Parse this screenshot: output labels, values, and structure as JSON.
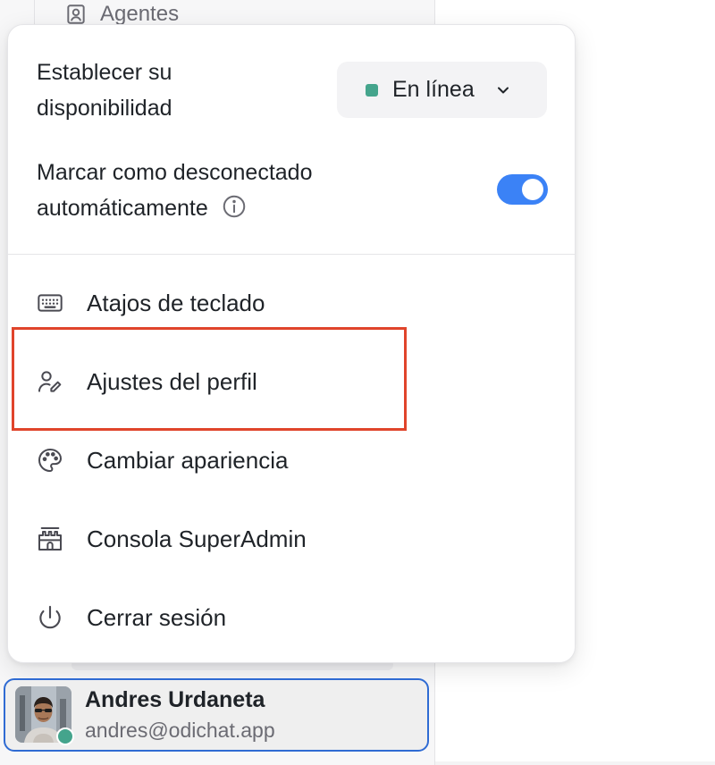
{
  "background": {
    "sidebar_item_label": "Agentes"
  },
  "availability": {
    "label": "Establecer su disponibilidad",
    "status_label": "En línea",
    "status_color": "#44a48c"
  },
  "auto_offline": {
    "label": "Marcar como desconectado automáticamente",
    "enabled": true,
    "toggle_color": "#3b82f6"
  },
  "menu": {
    "items": [
      {
        "label": "Atajos de teclado",
        "icon": "keyboard-icon"
      },
      {
        "label": "Ajustes del perfil",
        "icon": "user-pen-icon"
      },
      {
        "label": "Cambiar apariencia",
        "icon": "palette-icon"
      },
      {
        "label": "Consola SuperAdmin",
        "icon": "castle-icon"
      },
      {
        "label": "Cerrar sesión",
        "icon": "power-icon"
      }
    ],
    "highlight_color": "#e0442b"
  },
  "user": {
    "name": "Andres Urdaneta",
    "email": "andres@odichat.app",
    "status_color": "#44a48c"
  }
}
